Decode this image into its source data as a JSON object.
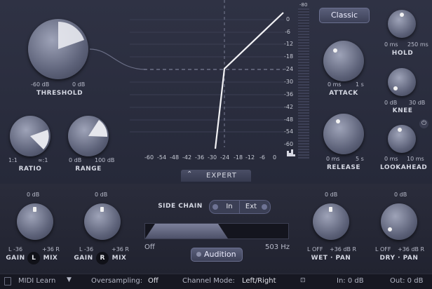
{
  "threshold": {
    "label": "THRESHOLD",
    "min": "-60 dB",
    "max": "0 dB"
  },
  "ratio": {
    "label": "RATIO",
    "min": "1:1",
    "max": "∞:1"
  },
  "range": {
    "label": "RANGE",
    "min": "0 dB",
    "max": "100 dB"
  },
  "graph": {
    "x_ticks": [
      "-60",
      "-54",
      "-48",
      "-42",
      "-36",
      "-30",
      "-24",
      "-18",
      "-12",
      "-6",
      "0"
    ],
    "y_ticks": [
      "0",
      "-6",
      "-12",
      "-18",
      "-24",
      "-30",
      "-36",
      "-42",
      "-48",
      "-54",
      "-60"
    ],
    "meter_top": "-80",
    "expert_label": "EXPERT",
    "expert_icon": "double-chevron-up-icon"
  },
  "style_button": {
    "label": "Classic"
  },
  "hold": {
    "label": "HOLD",
    "min": "0 ms",
    "max": "250 ms"
  },
  "attack": {
    "label": "ATTACK",
    "min": "0 ms",
    "max": "1 s"
  },
  "knee": {
    "label": "KNEE",
    "min": "0 dB",
    "max": "30 dB"
  },
  "release": {
    "label": "RELEASE",
    "min": "0 ms",
    "max": "5 s"
  },
  "lookahead": {
    "label": "LOOKAHEAD",
    "min": "0 ms",
    "max": "10 ms"
  },
  "power_icon": "power-icon",
  "gain_l": {
    "top": "0 dB",
    "min": "L -36",
    "max": "+36 R",
    "label": "GAIN",
    "badge": "L",
    "mix": "MIX"
  },
  "gain_r": {
    "top": "0 dB",
    "min": "L -36",
    "max": "+36 R",
    "label": "GAIN",
    "badge": "R",
    "mix": "MIX"
  },
  "side_chain": {
    "label": "SIDE CHAIN",
    "in": "In",
    "ext": "Ext",
    "low": "Off",
    "high": "503 Hz",
    "audition": "Audition"
  },
  "wet": {
    "top": "0 dB",
    "min": "L OFF",
    "max": "+36 dB R",
    "label": "WET · PAN"
  },
  "dry": {
    "top": "0 dB",
    "min": "L OFF",
    "max": "+36 dB R",
    "label": "DRY · PAN"
  },
  "status": {
    "midi_learn": "MIDI Learn",
    "oversampling_label": "Oversampling:",
    "oversampling_value": "Off",
    "channel_label": "Channel Mode:",
    "channel_value": "Left/Right",
    "in_label": "In: 0 dB",
    "out_label": "Out: 0 dB"
  }
}
